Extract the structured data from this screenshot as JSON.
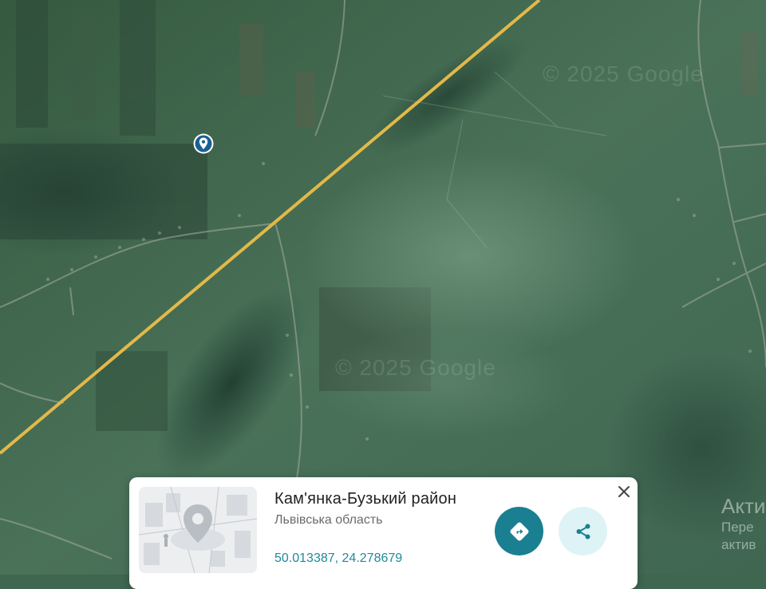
{
  "map": {
    "watermark_top": "© 2025 Google",
    "watermark_mid": "© 2025 Google",
    "pin_icon": "location-pin-icon",
    "partial_overlay_line1": "Акти",
    "partial_overlay_line2": "Пере",
    "partial_overlay_line3": "актив"
  },
  "place_card": {
    "name": "Кам'янка-Бузький район",
    "region": "Львівська область",
    "coordinates": "50.013387, 24.278679",
    "directions_icon": "directions-icon",
    "share_icon": "share-icon",
    "close_icon": "close-icon",
    "thumbnail_icon": "map-placeholder-illustration",
    "accent_color": "#1a7f91",
    "coords_color": "#1e8a9a"
  }
}
